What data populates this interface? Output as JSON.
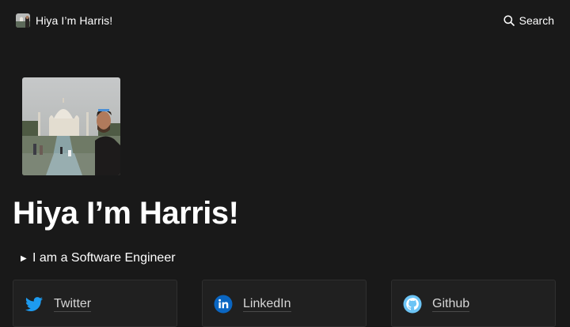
{
  "header": {
    "site_title": "Hiya I’m Harris!",
    "search_label": "Search",
    "search_icon": "search-icon"
  },
  "profile": {
    "avatar": "avatar-photo-taj-mahal",
    "title": "Hiya I’m Harris!",
    "toggle_label": "I am a Software Engineer",
    "toggle_icon": "triangle-right-icon"
  },
  "links": [
    {
      "label": "Twitter",
      "icon": "twitter-icon",
      "color": "#1d9bf0"
    },
    {
      "label": "LinkedIn",
      "icon": "linkedin-icon",
      "color": "#0a66c2"
    },
    {
      "label": "Github",
      "icon": "github-icon",
      "color": "#6cc4f5"
    }
  ],
  "colors": {
    "background": "#191919",
    "text": "#ebebeb",
    "card_background": "#202020"
  }
}
